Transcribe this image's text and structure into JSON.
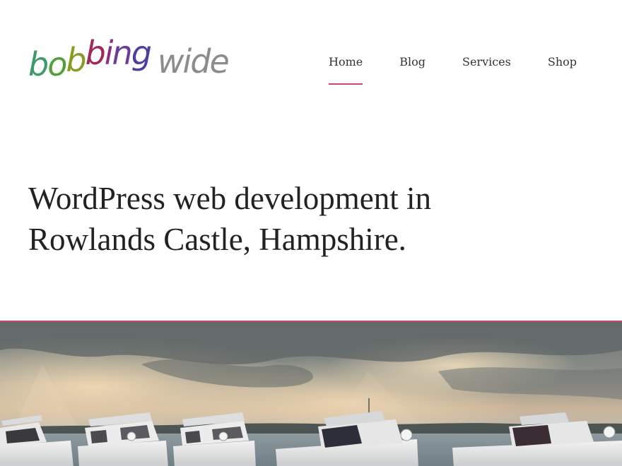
{
  "logo": {
    "parts": [
      {
        "text": "b",
        "color": "#3d9a6a"
      },
      {
        "text": "o",
        "color": "#52a03a"
      },
      {
        "text": "b",
        "color": "#8b9a22"
      },
      {
        "text": "b",
        "color": "#a3285a"
      },
      {
        "text": "i",
        "color": "#8a2f86"
      },
      {
        "text": "n",
        "color": "#6b3b9b"
      },
      {
        "text": "g",
        "color": "#4f3da0"
      },
      {
        "text": "wide",
        "color": "#8c8c8c"
      }
    ]
  },
  "nav": {
    "items": [
      {
        "label": "Home",
        "active": true
      },
      {
        "label": "Blog",
        "active": false
      },
      {
        "label": "Services",
        "active": false
      },
      {
        "label": "Shop",
        "active": false
      }
    ],
    "accent_color": "#d1436e"
  },
  "hero": {
    "line1": "WordPress web development in",
    "line2": "Rowlands Castle, Hampshire."
  }
}
